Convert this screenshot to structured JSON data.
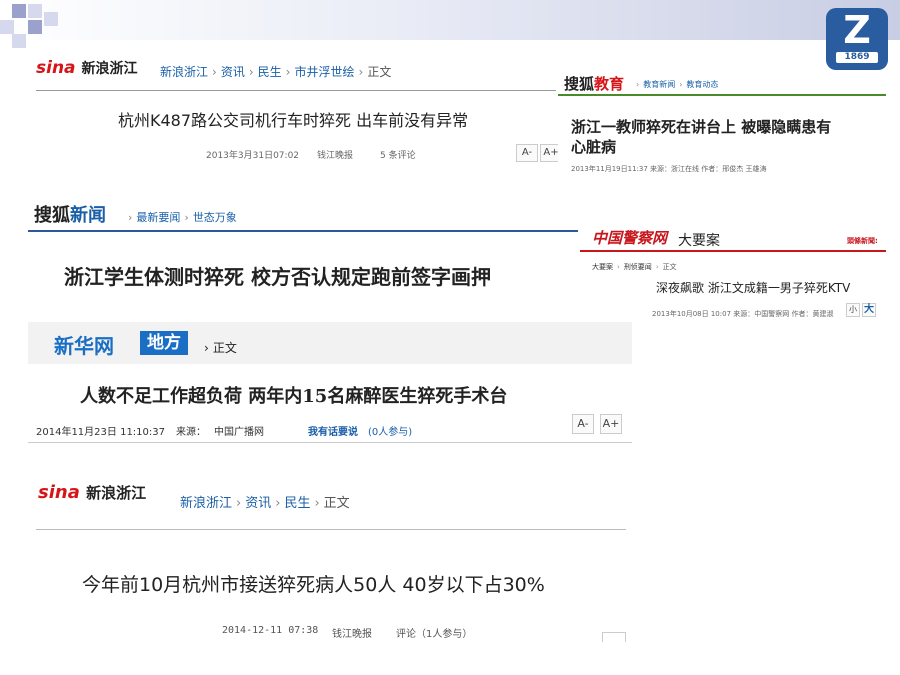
{
  "slide_logo": {
    "letter": "Z",
    "year": "1869"
  },
  "clip1": {
    "brand": "sina",
    "brand_region": "新浪浙江",
    "breadcrumb": [
      "新浪浙江",
      "资讯",
      "民生",
      "市井浮世绘",
      "正文"
    ],
    "headline": "杭州K487路公交司机行车时猝死  出车前没有异常",
    "date": "2013年3月31日07:02",
    "source": "钱江晚报",
    "comments": "5 条评论",
    "font_minus": "A-",
    "font_plus": "A+"
  },
  "clip2": {
    "brand": "搜狐",
    "brand_section": "教育",
    "breadcrumb": [
      "教育新闻",
      "教育动态"
    ],
    "headline_line1": "浙江一教师猝死在讲台上  被曝隐瞒患有",
    "headline_line2": "心脏病",
    "meta": "2013年11月19日11:37      来源：浙江在线  作者：邢俊杰  王雄涛"
  },
  "clip3": {
    "brand": "搜狐",
    "brand_section": "新闻",
    "breadcrumb": [
      "最新要闻",
      "世态万象"
    ],
    "headline": "浙江学生体测时猝死  校方否认规定跑前签字画押"
  },
  "clip4": {
    "brand": "中国警察网",
    "section": "大要案",
    "right_tag": "頭條新聞:",
    "breadcrumb": [
      "大要案",
      "刑侦要闻",
      "正文"
    ],
    "headline": "深夜飙歌  浙江文成籍一男子猝死KTV",
    "meta": "2013年10月08日  10:07     来源：中国警察网     作者：黄建淑",
    "font_small": "小",
    "font_big": "大"
  },
  "clip5": {
    "brand": "新华网",
    "section": "地方",
    "crumb": "正文",
    "headline": "人数不足工作超负荷  两年内15名麻醉医生猝死手术台",
    "date": "2014年11月23日  11:10:37",
    "source_label": "来源：",
    "source": "中国广播网",
    "comment_link": "我有话要说",
    "comment_count": "(0人参与)",
    "font_minus": "A-",
    "font_plus": "A+"
  },
  "clip6": {
    "brand": "sina",
    "brand_region": "新浪浙江",
    "breadcrumb": [
      "新浪浙江",
      "资讯",
      "民生",
      "正文"
    ],
    "headline": "今年前10月杭州市接送猝死病人50人 40岁以下占30%",
    "date": "2014-12-11 07:38",
    "source": "钱江晚报",
    "comments": "评论（1人参与）"
  }
}
